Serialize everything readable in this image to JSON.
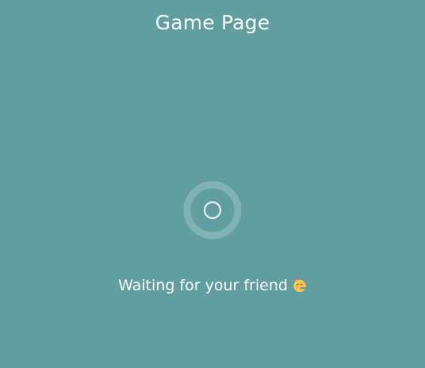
{
  "page": {
    "title": "Game Page",
    "background_color": "#619e9f"
  },
  "loader": {
    "icon": "loading-spinner-icon",
    "ring_color": "#7fb3b4",
    "inner_color": "#e6efef"
  },
  "status": {
    "message": "Waiting for your friend",
    "emoji_icon": "partying-face-emoji"
  }
}
